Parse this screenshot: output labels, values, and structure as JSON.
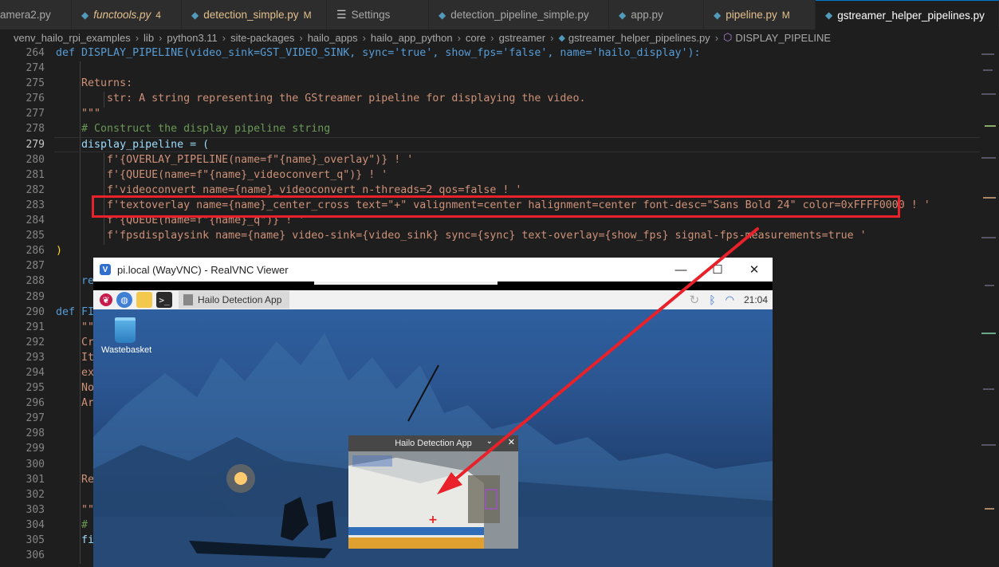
{
  "tabs": [
    {
      "label": "amera2.py",
      "icon": "python-icon",
      "state": "normal",
      "badge": ""
    },
    {
      "label": "functools.py",
      "icon": "python-icon",
      "state": "modified-italic",
      "badge": "4"
    },
    {
      "label": "detection_simple.py",
      "icon": "python-icon",
      "state": "modified",
      "badge": "M"
    },
    {
      "label": "Settings",
      "icon": "settings-icon",
      "state": "normal",
      "badge": ""
    },
    {
      "label": "detection_pipeline_simple.py",
      "icon": "python-icon",
      "state": "normal",
      "badge": ""
    },
    {
      "label": "app.py",
      "icon": "python-icon",
      "state": "normal",
      "badge": ""
    },
    {
      "label": "pipeline.py",
      "icon": "python-icon",
      "state": "modified",
      "badge": "M"
    },
    {
      "label": "gstreamer_helper_pipelines.py",
      "icon": "python-icon",
      "state": "active",
      "badge": ""
    }
  ],
  "breadcrumb": [
    "venv_hailo_rpi_examples",
    "lib",
    "python3.11",
    "site-packages",
    "hailo_apps",
    "hailo_app_python",
    "core",
    "gstreamer",
    "gstreamer_helper_pipelines.py",
    "DISPLAY_PIPELINE"
  ],
  "line_numbers": [
    "264",
    "274",
    "275",
    "276",
    "277",
    "278",
    "279",
    "280",
    "281",
    "282",
    "283",
    "284",
    "285",
    "286",
    "287",
    "288",
    "289",
    "290",
    "291",
    "292",
    "293",
    "294",
    "295",
    "296",
    "297",
    "298",
    "299",
    "300",
    "301",
    "302",
    "303",
    "304",
    "305",
    "306"
  ],
  "code_lines": {
    "l264": "def DISPLAY_PIPELINE(video_sink=GST_VIDEO_SINK, sync='true', show_fps='false', name='hailo_display'):",
    "l275": "Returns:",
    "l276": "str: A string representing the GStreamer pipeline for displaying the video.",
    "l277": "\"\"\"",
    "l278": "# Construct the display pipeline string",
    "l279": "display_pipeline = (",
    "l280": "f'{OVERLAY_PIPELINE(name=f\"{name}_overlay\")} ! '",
    "l281": "f'{QUEUE(name=f\"{name}_videoconvert_q\")} ! '",
    "l282": "f'videoconvert name={name}_videoconvert n-threads=2 qos=false ! '",
    "l283": "f'textoverlay name={name}_center_cross text=\"+\" valignment=center halignment=center font-desc=\"Sans Bold 24\" color=0xFFFF0000 ! '",
    "l284": "f'{QUEUE(name=f\"{name}_q\")} ! '",
    "l285": "f'fpsdisplaysink name={name} video-sink={video_sink} sync={sync} text-overlay={show_fps} signal-fps-measurements=true '",
    "l286": ")",
    "l288": "re",
    "l290": "def FI",
    "l291": "\"\"",
    "l292": "Cr",
    "l293": "It",
    "l294": "ex",
    "l295": "No",
    "l296": "Ar",
    "l301": "Re",
    "l303": "\"\"",
    "l304": "# ",
    "l305": "fi"
  },
  "vnc_window": {
    "title": "pi.local (WayVNC) - RealVNC Viewer",
    "minimize": "—",
    "maximize": "☐",
    "close": "✕"
  },
  "rpi_taskbar": {
    "task_label": "Hailo Detection App",
    "clock": "21:04"
  },
  "desktop": {
    "wastebasket_label": "Wastebasket"
  },
  "app_window": {
    "title": "Hailo Detection App",
    "cross": "+",
    "close": "✕",
    "menu": "⌄"
  },
  "colors": {
    "highlight_box": "#e8212a",
    "arrow": "#e8212a",
    "keyword": "#569cd6",
    "function": "#dcdcaa",
    "parameter": "#9cdcfe",
    "string": "#ce9178",
    "comment": "#6a9955"
  }
}
